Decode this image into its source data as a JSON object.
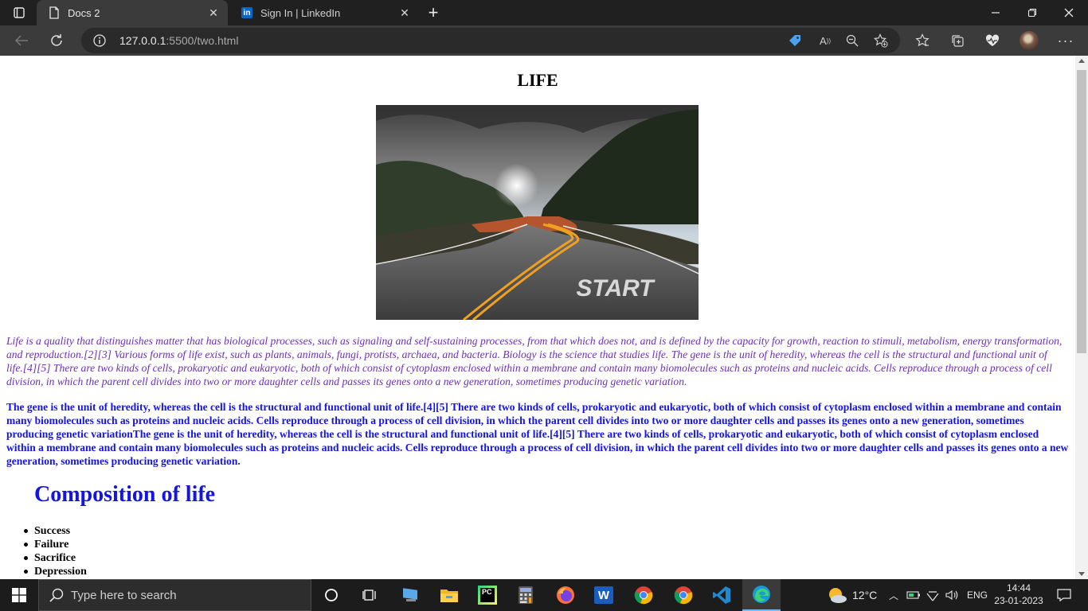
{
  "browser": {
    "tabs": [
      {
        "label": "Docs 2",
        "icon": "document-icon",
        "active": true
      },
      {
        "label": "Sign In | LinkedIn",
        "icon": "linkedin-icon",
        "active": false
      }
    ],
    "linkedin_badge": "in",
    "address": {
      "host": "127.0.0.1",
      "path": ":5500/two.html"
    },
    "window_controls": [
      "minimize",
      "restore",
      "close"
    ]
  },
  "page": {
    "title": "LIFE",
    "hero_image": {
      "overlay_text": "START",
      "description_icon": "road-landscape-image"
    },
    "intro_paragraph": "Life is a quality that distinguishes matter that has biological processes, such as signaling and self-sustaining processes, from that which does not, and is defined by the capacity for growth, reaction to stimuli, metabolism, energy transformation, and reproduction.[2][3] Various forms of life exist, such as plants, animals, fungi, protists, archaea, and bacteria. Biology is the science that studies life. The gene is the unit of heredity, whereas the cell is the structural and functional unit of life.[4][5] There are two kinds of cells, prokaryotic and eukaryotic, both of which consist of cytoplasm enclosed within a membrane and contain many biomolecules such as proteins and nucleic acids. Cells reproduce through a process of cell division, in which the parent cell divides into two or more daughter cells and passes its genes onto a new generation, sometimes producing genetic variation.",
    "bold_paragraph": "The gene is the unit of heredity, whereas the cell is the structural and functional unit of life.[4][5] There are two kinds of cells, prokaryotic and eukaryotic, both of which consist of cytoplasm enclosed within a membrane and contain many biomolecules such as proteins and nucleic acids. Cells reproduce through a process of cell division, in which the parent cell divides into two or more daughter cells and passes its genes onto a new generation, sometimes producing genetic variationThe gene is the unit of heredity, whereas the cell is the structural and functional unit of life.[4][5] There are two kinds of cells, prokaryotic and eukaryotic, both of which consist of cytoplasm enclosed within a membrane and contain many biomolecules such as proteins and nucleic acids. Cells reproduce through a process of cell division, in which the parent cell divides into two or more daughter cells and passes its genes onto a new generation, sometimes producing genetic variation.",
    "section_heading": "Composition of life",
    "list_items": [
      "Success",
      "Failure",
      "Sacrifice",
      "Depression"
    ],
    "colors": {
      "intro_text": "#6a2fb8",
      "bold_text": "#1414e6",
      "heading": "#1414e6"
    }
  },
  "taskbar": {
    "search_placeholder": "Type here to search",
    "pinned_apps": [
      "cortana-icon",
      "task-view-icon",
      "pc-icon",
      "file-explorer-icon",
      "pycharm-icon",
      "calculator-icon",
      "firefox-icon",
      "word-icon",
      "chrome-icon",
      "chrome-icon",
      "vscode-icon",
      "edge-icon"
    ],
    "pycharm_label": "PC",
    "word_label": "W",
    "weather": {
      "temp": "12°C",
      "icon": "cloudy-sun-icon"
    },
    "language": "ENG",
    "time": "14:44",
    "date": "23-01-2023"
  }
}
